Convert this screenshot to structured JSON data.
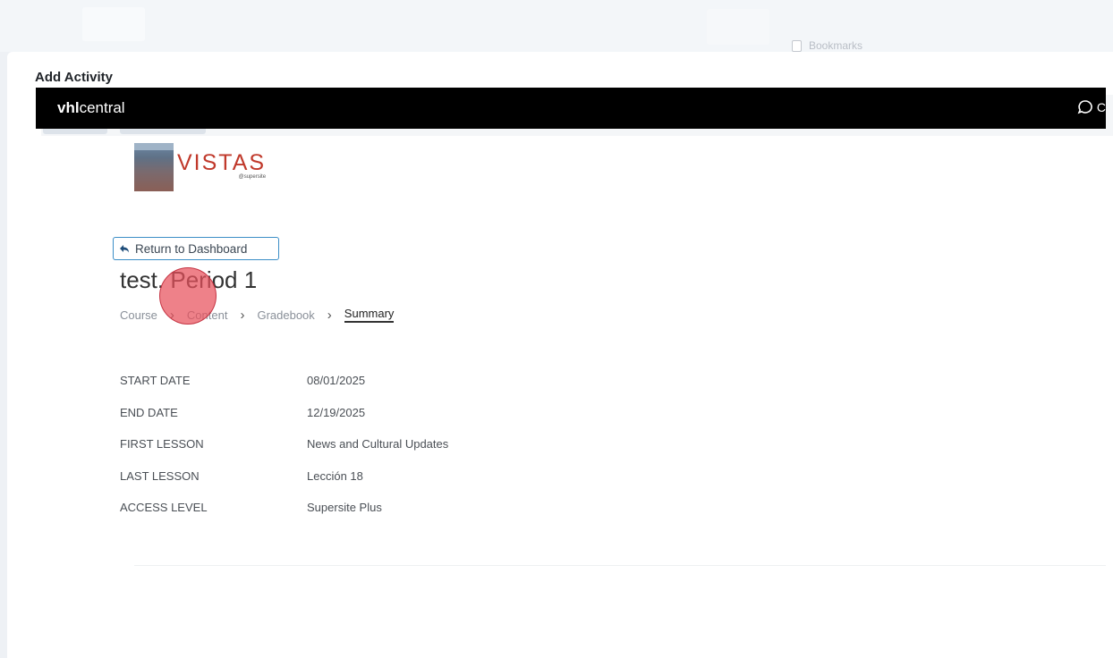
{
  "browser": {
    "bookmarks_label": "Bookmarks"
  },
  "panel": {
    "title": "Add Activity"
  },
  "toolbar": {
    "back_icon": "arrow-left-icon",
    "menu_icon": "chevron-down-icon"
  },
  "vhl": {
    "logo_bold": "vhl",
    "logo_rest": "central",
    "chat_icon": "chat-bubble-icon",
    "chat_label_partial": "C"
  },
  "book": {
    "title": "VISTAS",
    "edition": "@supersite"
  },
  "course": {
    "return_label": "Return to Dashboard",
    "title": "test. Period 1",
    "breadcrumb": [
      {
        "label": "Course"
      },
      {
        "label": "Content"
      },
      {
        "label": "Gradebook"
      },
      {
        "label": "Summary"
      }
    ]
  },
  "details": [
    {
      "label": "START DATE",
      "value": "08/01/2025"
    },
    {
      "label": "END DATE",
      "value": "12/19/2025"
    },
    {
      "label": "FIRST LESSON",
      "value": "News and Cultural Updates"
    },
    {
      "label": "LAST LESSON",
      "value": "Lección 18"
    },
    {
      "label": "ACCESS LEVEL",
      "value": "Supersite Plus"
    }
  ],
  "colors": {
    "accent_red": "#c0392b",
    "focus_blue": "#3c8ec7",
    "header_black": "#000000"
  }
}
